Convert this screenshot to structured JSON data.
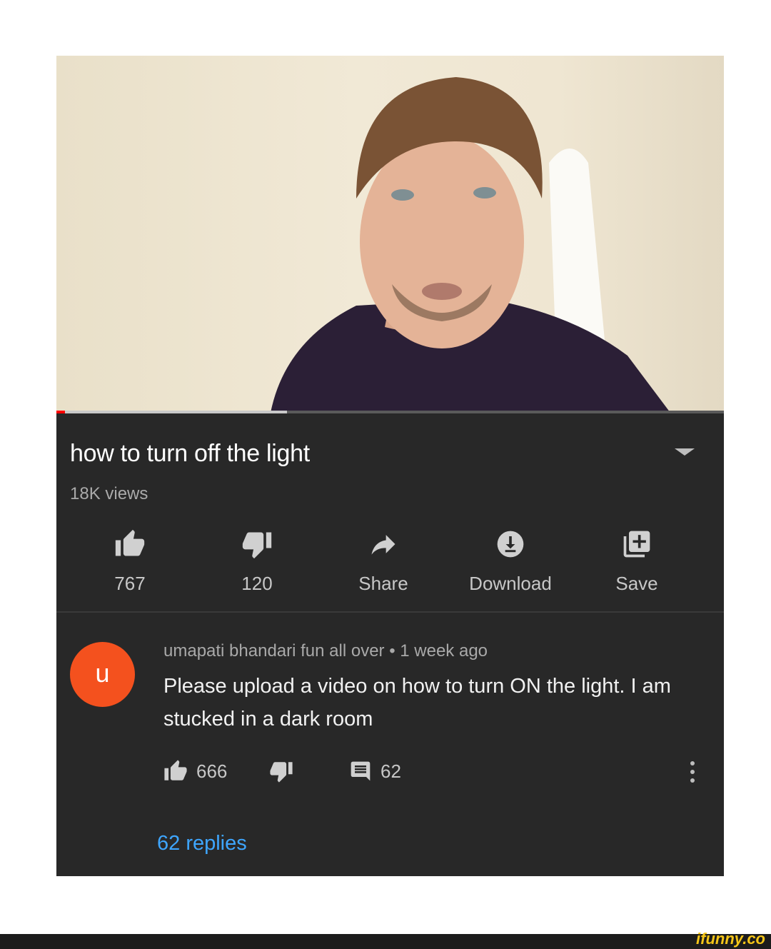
{
  "video": {
    "title": "how to turn off the light",
    "views": "18K views",
    "progress": 0.345
  },
  "actions": [
    {
      "icon": "thumbs-up-icon",
      "label": "767"
    },
    {
      "icon": "thumbs-down-icon",
      "label": "120"
    },
    {
      "icon": "share-icon",
      "label": "Share"
    },
    {
      "icon": "download-icon",
      "label": "Download"
    },
    {
      "icon": "save-playlist-icon",
      "label": "Save"
    }
  ],
  "comment": {
    "avatar_letter": "u",
    "meta": "umapati bhandari fun all over • 1 week ago",
    "text": "Please upload a video on how to turn ON the light. I am stucked in a dark room",
    "likes": "666",
    "reply_count": "62",
    "replies_link": "62 replies"
  },
  "colors": {
    "panel": "#282828",
    "accent_link": "#3ea6ff",
    "avatar": "#f4511e",
    "progress_red": "#ff0000"
  },
  "watermark": "ifunny.co"
}
